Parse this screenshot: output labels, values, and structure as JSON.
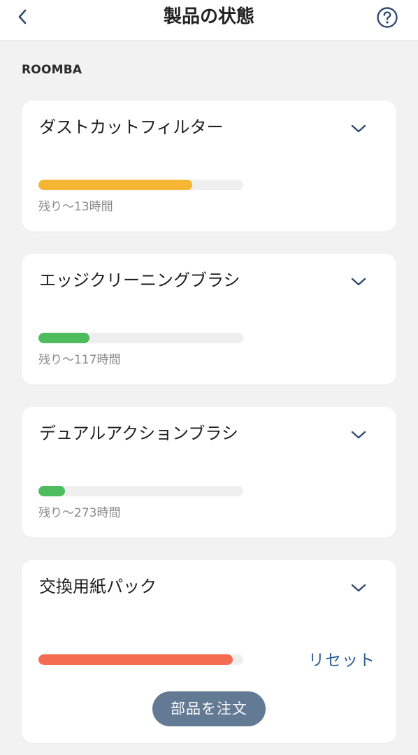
{
  "header": {
    "title": "製品の状態"
  },
  "section": {
    "label": "ROOMBA"
  },
  "parts": [
    {
      "name": "ダストカットフィルター",
      "remaining": "残り〜13時間",
      "level_percent": 75,
      "bar_color": "#f4b633"
    },
    {
      "name": "エッジクリーニングブラシ",
      "remaining": "残り〜117時間",
      "level_percent": 25,
      "bar_color": "#4cbc5c"
    },
    {
      "name": "デュアルアクションブラシ",
      "remaining": "残り〜273時間",
      "level_percent": 13,
      "bar_color": "#4cbc5c"
    },
    {
      "name": "交換用紙パック",
      "level_percent": 95,
      "bar_color": "#f36b50",
      "reset_label": "リセット",
      "order_label": "部品を注文"
    }
  ],
  "colors": {
    "accent_link": "#2d5d96",
    "order_button": "#627a93",
    "icon": "#2d4a6e"
  },
  "icons": {
    "back": "chevron-left-icon",
    "help": "question-circle-icon",
    "expand": "chevron-down-icon"
  }
}
